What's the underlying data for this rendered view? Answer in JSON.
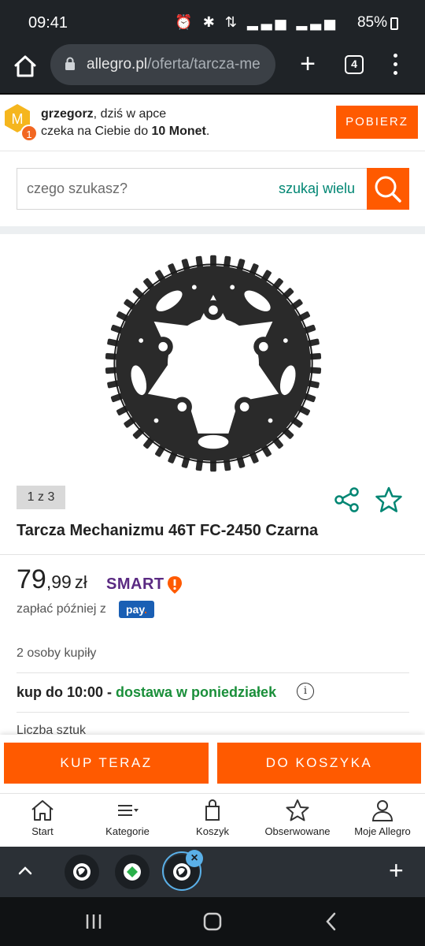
{
  "status_bar": {
    "time": "09:41",
    "icons": "⏰ ✱ ⇅ ▂▃▅ ▂▃▅",
    "battery": "85%"
  },
  "browser": {
    "url_domain": "allegro.pl",
    "url_path": "/oferta/tarcza-me",
    "tab_count": "4",
    "plus": "+",
    "home_icon": "home-icon",
    "lock_icon": "lock-icon"
  },
  "coins_banner": {
    "badge_letter": "M",
    "badge_count": "1",
    "user": "grzegorz",
    "line1_rest": ", dziś w apce",
    "line2_pre": "czeka na Ciebie do ",
    "line2_bold": "10 Monet",
    "line2_post": ".",
    "button": "POBIERZ"
  },
  "search": {
    "placeholder": "czego szukasz?",
    "multi_label": "szukaj wielu",
    "search_icon": "search-icon"
  },
  "product": {
    "image_counter": "1 z 3",
    "title": "Tarcza Mechanizmu 46T FC-2450 Czarna",
    "price_int": "79",
    "price_dec": ",99",
    "currency": "zł",
    "smart_label": "SMART",
    "pay_later_text": "zapłać później z",
    "pay_badge": "pay",
    "pay_badge_dot": ".",
    "bought_text": "2 osoby kupiły",
    "delivery_pre": "kup do 10:00",
    "delivery_sep": " - ",
    "delivery_green": "dostawa w poniedziałek",
    "info_glyph": "i",
    "quantity_label": "Liczba sztuk"
  },
  "actions": {
    "buy_now": "KUP TERAZ",
    "add_to_cart": "DO KOSZYKA"
  },
  "bottom_nav": {
    "items": [
      {
        "label": "Start",
        "icon": "home-icon"
      },
      {
        "label": "Kategorie",
        "icon": "categories-icon"
      },
      {
        "label": "Koszyk",
        "icon": "cart-icon"
      },
      {
        "label": "Obserwowane",
        "icon": "star-icon"
      },
      {
        "label": "Moje Allegro",
        "icon": "user-icon"
      }
    ]
  },
  "tab_strip": {
    "close_glyph": "×",
    "plus": "+"
  },
  "colors": {
    "brand_orange": "#ff5a00",
    "accent_teal": "#008673",
    "smart_purple": "#5a2a82",
    "delivery_green": "#1a8f3a"
  }
}
